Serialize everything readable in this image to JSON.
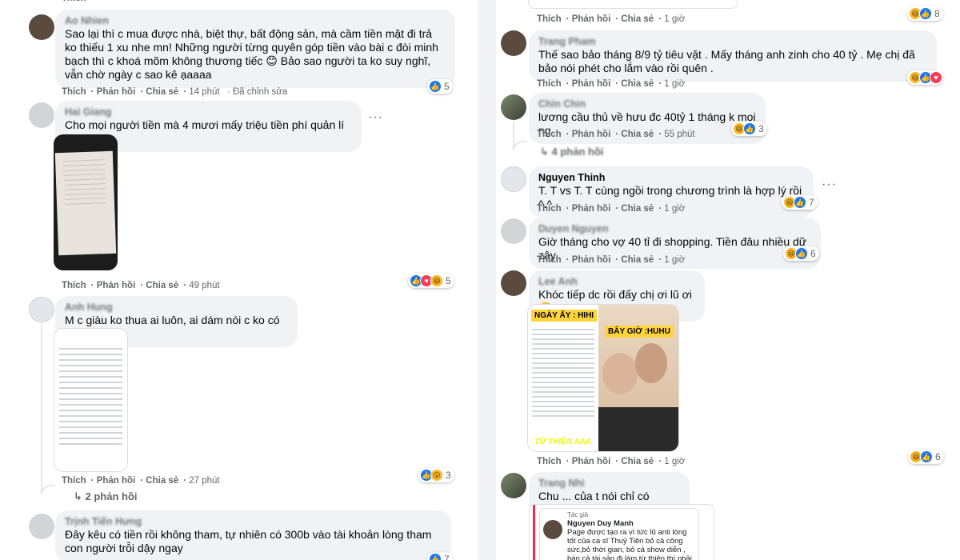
{
  "actions": {
    "like": "Thích",
    "reply": "Phản hồi",
    "share": "Chia sẻ"
  },
  "colors": {
    "like": "#1877f2",
    "haha": "#f7b928",
    "love": "#f33e58",
    "meta": "#65676b",
    "bubble": "#f0f2f5"
  },
  "left": {
    "c1": {
      "name": "Ao Nhien",
      "text": "Sao lại thì c mua được nhà, biệt thự, bất động sản, mà cầm tiền mặt đi trả ko thiếu 1 xu nhe mn! Những người từng quyên góp tiền vào bài c đòi minh bạch thì c khoá mõm không thương tiếc 😊 Bảo sao người ta ko suy nghĩ, vẫn chờ ngày c sao kê ạaaaa",
      "time": "14 phút",
      "edited": "· Đã chỉnh sửa",
      "reactions": "5"
    },
    "c2": {
      "name": "Hai Giang",
      "text": "Cho mọi người tiền mà 4 mươi mấy triệu tiền phí quản lí chị quỵt",
      "time": "49 phút",
      "reactions": "5",
      "more": "···"
    },
    "c3": {
      "name": "Anh Hung",
      "text": "M c giàu ko thua ai luôn, ai dám nói c ko có tiền 🤣",
      "time": "27 phút",
      "reactions": "3",
      "replies": "2 phản hồi"
    },
    "c4": {
      "name": "Trịnh Tiến Hưng",
      "text": "Đây kêu có tiền rồi không tham, tự nhiên có 300b vào tài khoản lòng tham con người trỗi dậy ngay",
      "reactions": "7"
    }
  },
  "right": {
    "top": {
      "time": "1 giờ",
      "reactions": "8"
    },
    "r1": {
      "name": "Trang Pham",
      "text": "Thế sao bảo tháng 8/9 tỷ tiêu vặt . Mấy tháng anh zinh cho 40 tỷ . Mẹ chị đã bảo nói phét cho lắm vào rồi quên .",
      "time": "1 giờ",
      "reactions": ""
    },
    "r2": {
      "name": "Chin Chin",
      "text": "lương cầu thủ về hưu đc 40tỷ 1 tháng k mọi ng",
      "time": "55 phút",
      "reactions": "3",
      "replies": "4 phản hồi"
    },
    "r3": {
      "name": "Nguyen Thinh",
      "text": "T. T vs T. T cùng ngồi trong chương trình là hợp lý rồi ^.^",
      "time": "1 giờ",
      "reactions": "7",
      "more": "···"
    },
    "r4": {
      "name": "Duyen Nguyen",
      "text": "Giờ tháng cho vợ 40 tỉ đi shopping. Tiền đâu nhiều dữ zậy",
      "time": "1 giờ",
      "reactions": "6"
    },
    "r5": {
      "name": "Lee Anh",
      "text": "Khóc tiếp dc rồi đấy chị ơi lũ ơi 🤣",
      "time": "1 giờ",
      "reactions": "6",
      "meme_top": "NGÀY ẤY : HIHI",
      "meme_right": "BÂY GIỜ :HUHU",
      "meme_bottom": "TỪ THIỆN AAA"
    },
    "r6": {
      "name": "Trang Nhi",
      "text": "Chu ... của t nói chỉ có chuẩn",
      "share_role": "Tác giả",
      "share_name": "Nguyen Duy Manh",
      "share_text": "Page được tạo ra vì tức lũ anti lòng tốt của ca sĩ Thuỷ Tiên bỏ cả công sức,bỏ thời gian, bỏ cả show diễn , bán cả tài sản đi làm từ thiện thì phải nhận phải chịu"
    }
  }
}
